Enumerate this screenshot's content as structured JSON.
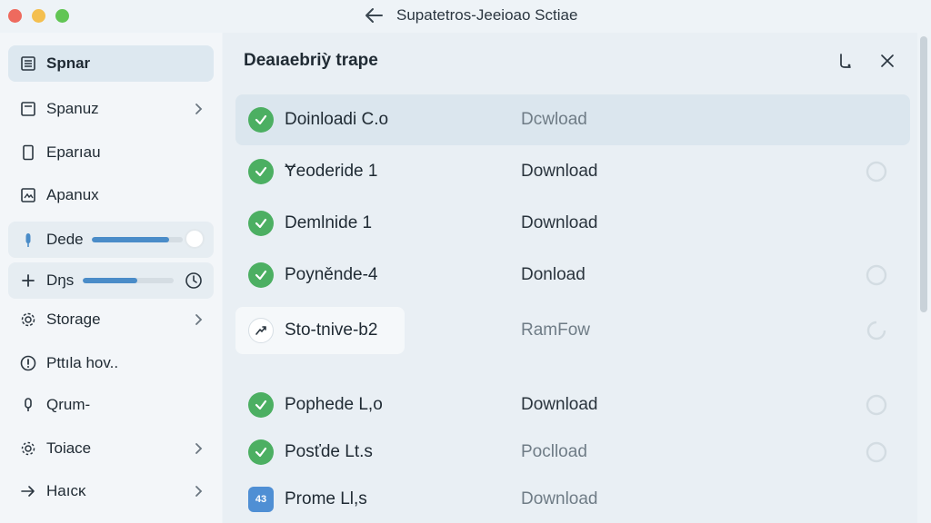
{
  "window": {
    "title": "Supatetros-Jeeioao Sctiae"
  },
  "colors": {
    "accent": "#4a8cc8",
    "success": "#4caf62",
    "info": "#4f8fd4"
  },
  "sidebar": {
    "items": [
      {
        "label": "Spnar",
        "icon": "list-icon",
        "active": true,
        "chevron": false
      },
      {
        "label": "Spanuz",
        "icon": "document-icon",
        "active": false,
        "chevron": true
      },
      {
        "label": "Eparıau",
        "icon": "tablet-icon",
        "active": false,
        "chevron": false
      },
      {
        "label": "Apanux",
        "icon": "image-icon",
        "active": false,
        "chevron": false
      },
      {
        "label": "Dede",
        "icon": "microphone-icon",
        "active": false,
        "chevron": false,
        "progress": 0.85
      },
      {
        "label": "Dŋs",
        "icon": "plus-icon",
        "active": false,
        "chevron": false,
        "progress": 0.6
      },
      {
        "label": "Storage",
        "icon": "gear-icon",
        "active": false,
        "chevron": true
      },
      {
        "label": "Pttıla hov..",
        "icon": "alert-icon",
        "active": false,
        "chevron": false
      },
      {
        "label": "Qrum-",
        "icon": "mic-icon",
        "active": false,
        "chevron": false
      },
      {
        "label": "Toiace",
        "icon": "settings-icon",
        "active": false,
        "chevron": true
      },
      {
        "label": "Haıcĸ",
        "icon": "arrow-right-icon",
        "active": false,
        "chevron": true
      }
    ]
  },
  "main": {
    "title": "Deaıaebriỳ trape",
    "rows": [
      {
        "name": "Doinloadi C.o",
        "action": "Dcwload",
        "status": "ok",
        "muted": true,
        "highlight": true
      },
      {
        "name": "Ɏeoderide 1",
        "action": "Download",
        "status": "ok",
        "muted": false
      },
      {
        "name": "Demlnide 1",
        "action": "Download",
        "status": "ok",
        "muted": false
      },
      {
        "name": "Poyněnde-4",
        "action": "Donload",
        "status": "ok",
        "muted": false
      },
      {
        "name": "Sto-tnive-b2",
        "action": "RamFow",
        "status": "trend",
        "muted": true
      },
      {
        "name": "Pophede L,o",
        "action": "Download",
        "status": "ok",
        "muted": false
      },
      {
        "name": "Posťde Lt.s",
        "action": "Poclload",
        "status": "ok",
        "muted": true
      },
      {
        "name": "Prome Ll,s",
        "action": "Download",
        "status": "info",
        "muted": true,
        "badge": "43"
      }
    ]
  }
}
